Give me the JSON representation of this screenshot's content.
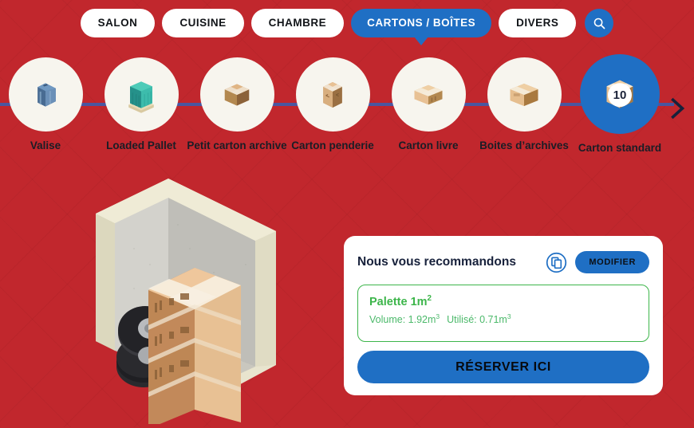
{
  "theme": {
    "background_red": "#C1272D",
    "accent_blue": "#1F6FC4",
    "green": "#3CB54A",
    "dark_navy": "#17213B",
    "circle_cream": "#F7F5EE",
    "connector_blue": "#4A56A0"
  },
  "tabs": [
    {
      "label": "SALON",
      "active": false
    },
    {
      "label": "CUISINE",
      "active": false
    },
    {
      "label": "CHAMBRE",
      "active": false
    },
    {
      "label": "CARTONS / BOÎTES",
      "active": true
    },
    {
      "label": "DIVERS",
      "active": false
    }
  ],
  "search": {
    "icon": "search-icon"
  },
  "carousel": {
    "next_icon": "chevron-right-icon",
    "items": [
      {
        "label": "Valise",
        "icon": "suitcase-icon",
        "selected": false,
        "quantity": null
      },
      {
        "label": "Loaded Pallet",
        "icon": "wrapped-pallet-icon",
        "selected": false,
        "quantity": null
      },
      {
        "label": "Petit carton archive",
        "icon": "small-archive-box-icon",
        "selected": false,
        "quantity": null
      },
      {
        "label": "Carton penderie",
        "icon": "wardrobe-box-icon",
        "selected": false,
        "quantity": null
      },
      {
        "label": "Carton livre",
        "icon": "book-box-icon",
        "selected": false,
        "quantity": null
      },
      {
        "label": "Boites d’archives",
        "icon": "archive-box-icon",
        "selected": false,
        "quantity": null
      },
      {
        "label": "Carton standard",
        "icon": "standard-box-icon",
        "selected": true,
        "quantity": "10"
      }
    ]
  },
  "illustration": {
    "name": "storage-unit-illustration"
  },
  "card": {
    "title": "Nous vous recommandons",
    "copy_icon": "copy-icon",
    "modify_label": "MODIFIER",
    "result": {
      "name": "Palette 1m",
      "name_sup": "2",
      "volume_label": "Volume: 1.92m",
      "volume_sup": "3",
      "used_label": "Utilisé: 0.71m",
      "used_sup": "3"
    },
    "reserve_label": "RÉSERVER ICI"
  }
}
